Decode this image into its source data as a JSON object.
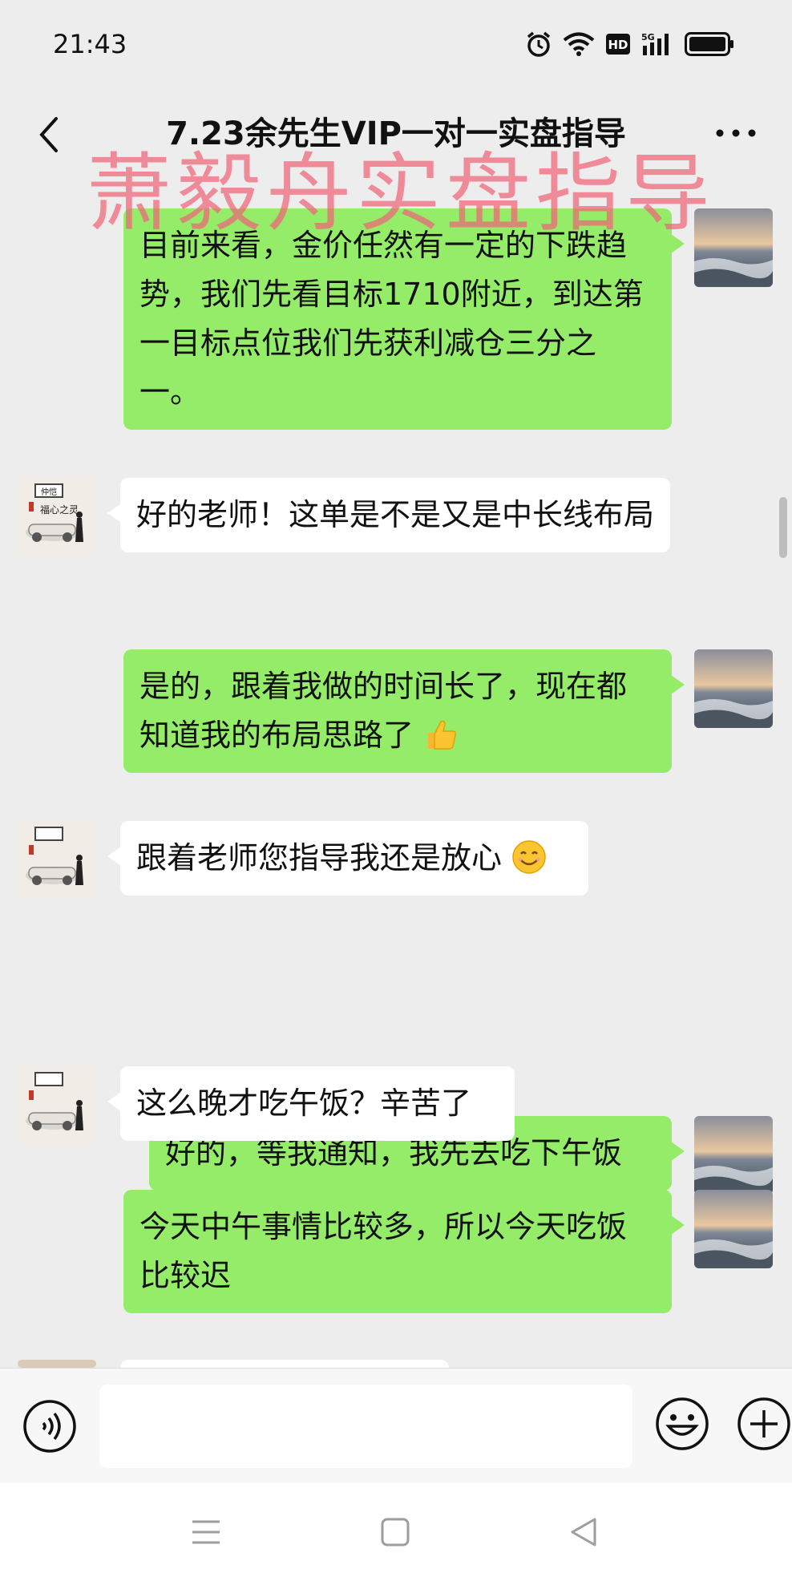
{
  "status_bar": {
    "time": "21:43",
    "icons": [
      "alarm-icon",
      "wifi-icon",
      "hd-icon",
      "5g-signal-icon",
      "battery-icon"
    ],
    "hd_label": "HD",
    "network_label": "5G"
  },
  "header": {
    "title": "7.23余先生VIP一对一实盘指导",
    "watermark": "萧毅舟实盘指导"
  },
  "messages": [
    {
      "side": "right",
      "text": "目前来看，金价任然有一定的下跌趋势，我们先看目标1710附近，到达第一目标点位我们先获利减仓三分之一。"
    },
    {
      "side": "left",
      "text": "好的老师！这单是不是又是中长线布局"
    },
    {
      "side": "right",
      "text": "是的，跟着我做的时间长了，现在都知道我的布局思路了",
      "emoji": "thumbs-up"
    },
    {
      "side": "left",
      "text": "跟着老师您指导我还是放心",
      "emoji": "smiling-face"
    },
    {
      "side": "right",
      "text": "好的，等我通知，我先去吃下午饭"
    },
    {
      "side": "left",
      "text": "这么晚才吃午饭？辛苦了"
    },
    {
      "side": "right",
      "text": "今天中午事情比较多，所以今天吃饭比较迟"
    }
  ],
  "avatar_left_text": {
    "top": "仲恺",
    "main": "福心之灵"
  },
  "colors": {
    "background": "#ededed",
    "bubble_sent": "#95ec69",
    "bubble_received": "#ffffff",
    "watermark": "#f06478"
  },
  "input_bar": {
    "placeholder": ""
  },
  "icons": {
    "back": "back-arrow-icon",
    "more": "more-dots-icon",
    "voice": "voice-icon",
    "emoji": "emoji-icon",
    "plus": "plus-icon",
    "nav": [
      "menu-icon",
      "home-icon",
      "back-triangle-icon"
    ]
  }
}
